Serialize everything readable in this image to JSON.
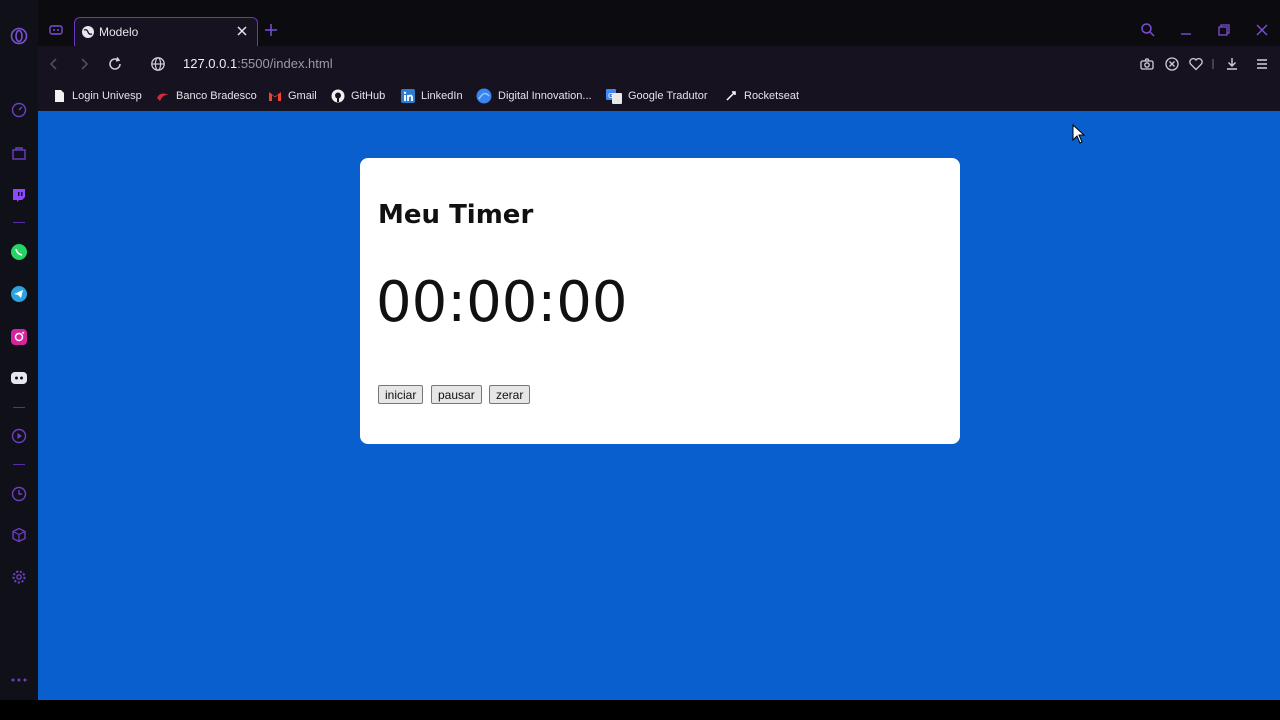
{
  "browser": {
    "tab": {
      "title": "Modelo",
      "favicon": "globe-icon"
    },
    "url": {
      "host": "127.0.0.1",
      "rest": ":5500/index.html"
    },
    "accent": "#6b35c7"
  },
  "bookmarks": [
    {
      "label": "Login Univesp",
      "icon": "document-icon"
    },
    {
      "label": "Banco Bradesco",
      "icon": "bradesco-icon"
    },
    {
      "label": "Gmail",
      "icon": "gmail-icon"
    },
    {
      "label": "GitHub",
      "icon": "github-icon"
    },
    {
      "label": "LinkedIn",
      "icon": "linkedin-icon"
    },
    {
      "label": "Digital Innovation...",
      "icon": "dio-icon"
    },
    {
      "label": "Google Tradutor",
      "icon": "translate-icon"
    },
    {
      "label": "Rocketseat",
      "icon": "rocket-icon"
    }
  ],
  "page": {
    "background": "#0a5fcf",
    "title": "Meu Timer",
    "timer": "00:00:00",
    "buttons": {
      "start": "iniciar",
      "pause": "pausar",
      "reset": "zerar"
    }
  }
}
